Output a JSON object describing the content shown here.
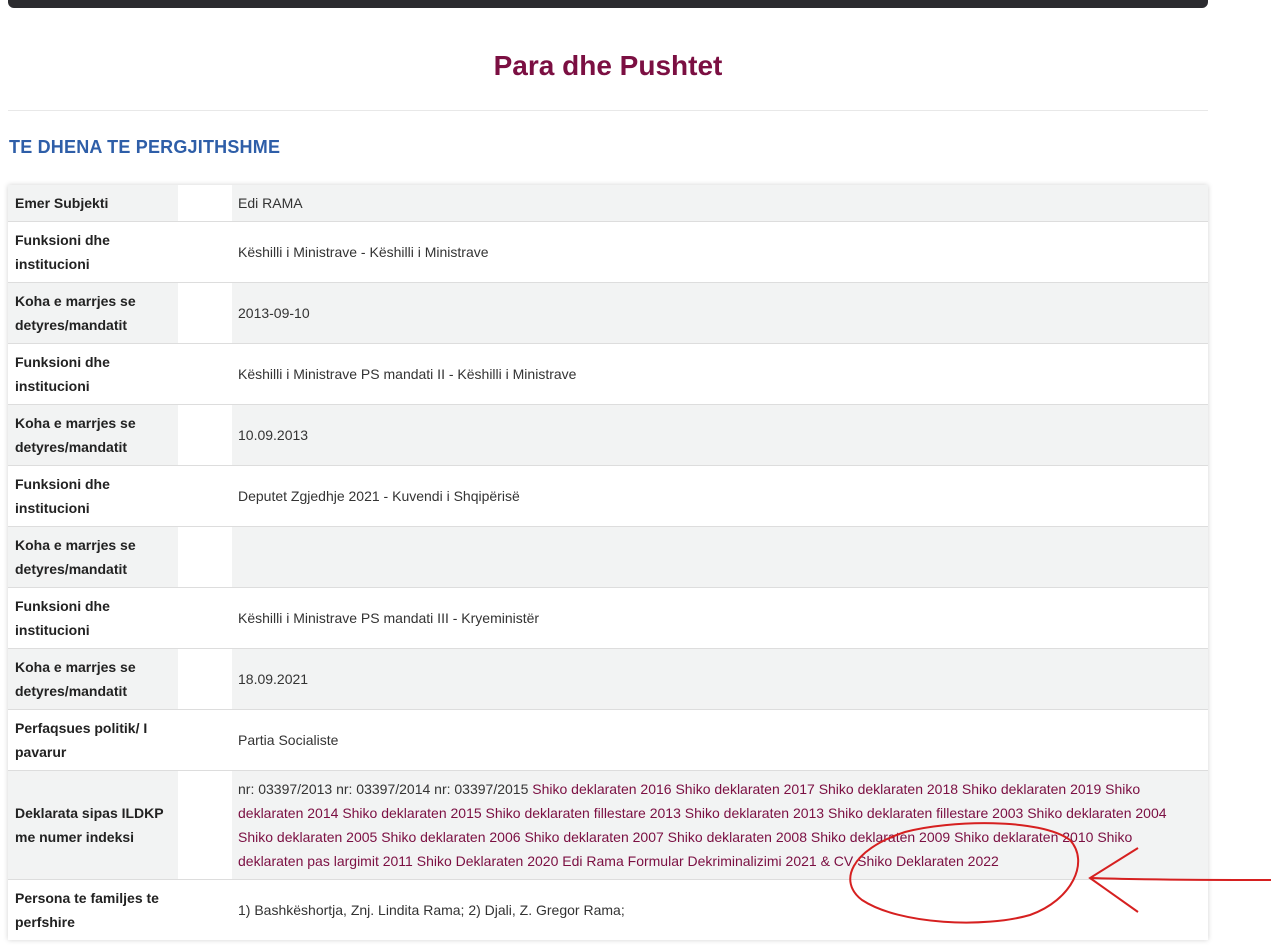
{
  "page": {
    "title": "Para dhe Pushtet",
    "section_heading": "TE DHENA TE PERGJITHSHME"
  },
  "rows": [
    {
      "label": "Emer Subjekti",
      "value": "Edi RAMA"
    },
    {
      "label": "Funksioni dhe institucioni",
      "value": "Këshilli i Ministrave - Këshilli i Ministrave"
    },
    {
      "label": "Koha e marrjes se detyres/mandatit",
      "value": "2013-09-10"
    },
    {
      "label": "Funksioni dhe institucioni",
      "value": "Këshilli i Ministrave PS mandati II - Këshilli i Ministrave"
    },
    {
      "label": "Koha e marrjes se detyres/mandatit",
      "value": "10.09.2013"
    },
    {
      "label": "Funksioni dhe institucioni",
      "value": "Deputet Zgjedhje 2021 - Kuvendi i Shqipërisë"
    },
    {
      "label": "Koha e marrjes se detyres/mandatit",
      "value": ""
    },
    {
      "label": "Funksioni dhe institucioni",
      "value": "Këshilli i Ministrave PS mandati III - Kryeministër"
    },
    {
      "label": "Koha e marrjes se detyres/mandatit",
      "value": "18.09.2021"
    },
    {
      "label": "Perfaqsues politik/ I pavarur",
      "value": "Partia Socialiste"
    },
    {
      "label": "Deklarata sipas ILDKP me numer indeksi",
      "value": ""
    },
    {
      "label": "Persona te familjes te perfshire",
      "value": "1) Bashkëshortja, Znj. Lindita Rama; 2) Djali, Z. Gregor Rama;"
    }
  ],
  "declarations": {
    "index_numbers": "nr: 03397/2013 nr: 03397/2014 nr: 03397/2015",
    "links": [
      "Shiko deklaraten 2016",
      "Shiko deklaraten 2017",
      "Shiko deklaraten 2018",
      "Shiko deklaraten 2019",
      "Shiko deklaraten 2014",
      "Shiko deklaraten 2015",
      "Shiko deklaraten fillestare 2013",
      "Shiko deklaraten 2013",
      "Shiko deklaraten fillestare 2003",
      "Shiko deklaraten 2004",
      "Shiko deklaraten 2005",
      "Shiko deklaraten 2006",
      "Shiko deklaraten 2007",
      "Shiko deklaraten 2008",
      "Shiko deklaraten 2009",
      "Shiko deklaraten 2010",
      "Shiko deklaraten pas largimit 2011",
      "Shiko Deklaraten 2020",
      "Edi Rama Formular Dekriminalizimi 2021 & CV",
      "Shiko Deklaraten 2022"
    ]
  },
  "colors": {
    "title": "#7b0f42",
    "heading": "#2e5ea8",
    "link": "#7b0f42",
    "annotation": "#d62020"
  }
}
